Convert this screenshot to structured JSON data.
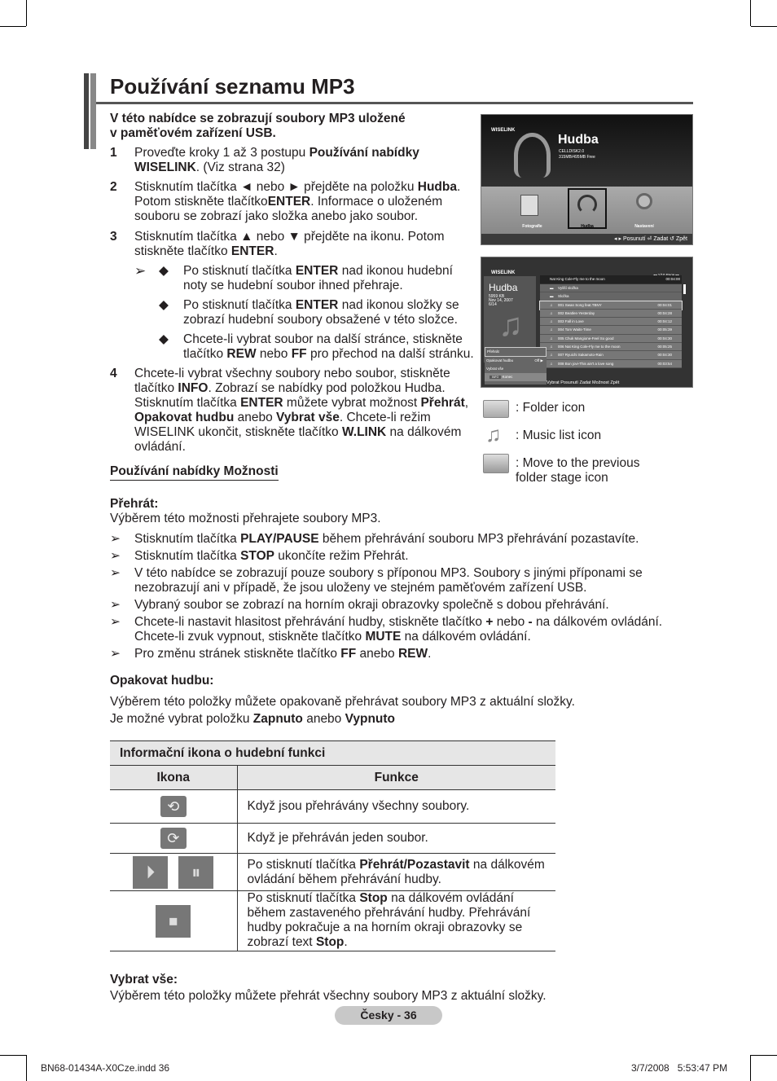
{
  "title": "Používání seznamu MP3",
  "intro": [
    [
      {
        "t": "V této nabídce se zobrazují soubory MP3 uložené",
        "b": 1
      }
    ],
    [
      {
        "t": "v paměťovém zařízení USB.",
        "b": 1
      }
    ]
  ],
  "steps": [
    {
      "n": "1",
      "text": [
        {
          "t": "Proveďte kroky 1 až 3 postupu "
        },
        {
          "t": "Používání nabídky WISELINK",
          "b": 1
        },
        {
          "t": ". (Viz strana 32)"
        }
      ]
    },
    {
      "n": "2",
      "text": [
        {
          "t": "Stisknutím tlačítka ◄ nebo ► přejděte na položku "
        },
        {
          "t": "Hudba",
          "b": 1
        },
        {
          "t": ". Potom stiskněte tlačítko"
        },
        {
          "t": "ENTER",
          "b": 1
        },
        {
          "t": ". Informace o uloženém souboru se zobrazí jako složka anebo jako soubor."
        }
      ]
    },
    {
      "n": "3",
      "text": [
        {
          "t": "Stisknutím tlačítka ▲ nebo ▼ přejděte na ikonu. Potom stiskněte tlačítko "
        },
        {
          "t": "ENTER",
          "b": 1
        },
        {
          "t": "."
        }
      ]
    },
    {
      "n": "4",
      "text": [
        {
          "t": "Chcete-li vybrat všechny soubory nebo soubor, stiskněte tlačítko "
        },
        {
          "t": "INFO",
          "b": 1
        },
        {
          "t": ". Zobrazí se nabídky pod položkou Hudba. Stisknutím tlačítka "
        },
        {
          "t": "ENTER",
          "b": 1
        },
        {
          "t": " můžete vybrat možnost "
        },
        {
          "t": "Přehrát",
          "b": 1
        },
        {
          "t": ", "
        },
        {
          "t": "Opakovat hudbu",
          "b": 1
        },
        {
          "t": " anebo "
        },
        {
          "t": "Vybrat vše",
          "b": 1
        },
        {
          "t": ". Chcete-li režim WISELINK ukončit, stiskněte tlačítko "
        },
        {
          "t": "W.LINK",
          "b": 1
        },
        {
          "t": " na dálkovém ovládání."
        }
      ]
    }
  ],
  "step3_notes": [
    [
      {
        "t": "Po stisknutí tlačítka "
      },
      {
        "t": "ENTER",
        "b": 1
      },
      {
        "t": " nad ikonou hudební noty se hudební soubor ihned přehraje."
      }
    ],
    [
      {
        "t": "Po stisknutí tlačítka "
      },
      {
        "t": "ENTER",
        "b": 1
      },
      {
        "t": " nad ikonou složky se zobrazí hudební soubory obsažené v této složce."
      }
    ],
    [
      {
        "t": "Chcete-li vybrat soubor na další stránce, stiskněte tlačítko "
      },
      {
        "t": "REW",
        "b": 1
      },
      {
        "t": " nebo "
      },
      {
        "t": "FF",
        "b": 1
      },
      {
        "t": " pro přechod na další stránku."
      }
    ]
  ],
  "options_heading": "Používání nabídky Možnosti",
  "play_heading": "Přehrát:",
  "play_desc": "Výběrem této možnosti přehrajete soubory MP3.",
  "play_notes": [
    [
      {
        "t": "Stisknutím tlačítka "
      },
      {
        "t": "PLAY/PAUSE",
        "b": 1
      },
      {
        "t": " během přehrávání souboru MP3 přehrávání pozastavíte."
      }
    ],
    [
      {
        "t": "Stisknutím tlačítka "
      },
      {
        "t": "STOP",
        "b": 1
      },
      {
        "t": " ukončíte režim Přehrát."
      }
    ],
    [
      {
        "t": "V této nabídce se zobrazují pouze soubory s příponou MP3. Soubory s jinými příponami se nezobrazují ani v případě, že jsou uloženy ve stejném paměťovém zařízení USB."
      }
    ],
    [
      {
        "t": "Vybraný soubor se zobrazí na horním okraji obrazovky společně s dobou přehrávání."
      }
    ],
    [
      {
        "t": "Chcete-li nastavit hlasitost přehrávání hudby, stiskněte tlačítko  "
      },
      {
        "t": "+",
        "b": 1
      },
      {
        "t": " nebo "
      },
      {
        "t": "-",
        "b": 1
      },
      {
        "t": " na dálkovém ovládání. Chcete-li zvuk vypnout, stiskněte tlačítko "
      },
      {
        "t": "MUTE",
        "b": 1
      },
      {
        "t": " na dálkovém ovládání."
      }
    ],
    [
      {
        "t": "Pro změnu stránek stiskněte tlačítko "
      },
      {
        "t": "FF",
        "b": 1
      },
      {
        "t": " anebo "
      },
      {
        "t": "REW",
        "b": 1
      },
      {
        "t": "."
      }
    ]
  ],
  "repeat_heading": "Opakovat hudbu:",
  "repeat_desc": [
    [
      {
        "t": "Výběrem této položky můžete opakovaně přehrávat soubory MP3 z aktuální složky."
      }
    ],
    [
      {
        "t": "Je možné vybrat položku "
      },
      {
        "t": "Zapnuto",
        "b": 1
      },
      {
        "t": " anebo "
      },
      {
        "t": "Vypnuto",
        "b": 1
      }
    ]
  ],
  "table": {
    "caption": "Informační ikona o hudební funkci",
    "col_icon": "Ikona",
    "col_func": "Funkce",
    "rows": [
      {
        "icons": [
          "repeat-all-icon"
        ],
        "text": [
          {
            "t": "Když jsou přehrávány všechny soubory."
          }
        ]
      },
      {
        "icons": [
          "repeat-one-icon"
        ],
        "text": [
          {
            "t": "Když je přehráván jeden soubor."
          }
        ]
      },
      {
        "icons": [
          "play-icon",
          "pause-icon"
        ],
        "text": [
          {
            "t": "Po stisknutí tlačítka "
          },
          {
            "t": "Přehrát/Pozastavit",
            "b": 1
          },
          {
            "t": " na dálkovém ovládání během přehrávání hudby."
          }
        ]
      },
      {
        "icons": [
          "stop-icon"
        ],
        "text": [
          {
            "t": "Po stisknutí tlačítka "
          },
          {
            "t": "Stop",
            "b": 1
          },
          {
            "t": " na dálkovém ovládání během zastaveného přehrávání hudby. Přehrávání hudby pokračuje a na horním okraji obrazovky se zobrazí text "
          },
          {
            "t": "Stop",
            "b": 1
          },
          {
            "t": "."
          }
        ]
      }
    ]
  },
  "selectall_heading": "Vybrat vše:",
  "selectall_desc": "Výběrem této položky můžete přehrát všechny soubory MP3 z aktuální složky.",
  "legend": [
    {
      "icon": "folder-icon",
      "label": ": Folder icon"
    },
    {
      "icon": "music-list-icon",
      "label": ": Music list icon"
    },
    {
      "icon": "previous-folder-icon",
      "label": ": Move to the previous folder stage icon"
    }
  ],
  "screen1": {
    "logo": "WISELINK",
    "title": "Hudba",
    "device": "CELLDISK2.0",
    "free": "315MB/495MB Free",
    "menu": [
      "Fotografie",
      "Hudba",
      "Nastavení"
    ],
    "footer": "◂ ▸ Posunutí   ⏎ Zadat   ↺ Zpět"
  },
  "screen2": {
    "logo": "WISELINK",
    "page": "◂◂ 1/10 Page ▸▸",
    "title": "Hudba",
    "size": "5959 KB",
    "date": "Nov 14, 2007",
    "pos": "6/14",
    "now_playing": "Nat King Cole-Fly me to the moon",
    "now_time": "00:04:00",
    "items": [
      {
        "name": "Vyšší složka",
        "time": ""
      },
      {
        "name": "Složka",
        "time": ""
      },
      {
        "name": "001 Swan Song feat.TBNY",
        "time": "00:04:01"
      },
      {
        "name": "002 Beatles-Yesterday",
        "time": "00:04:28"
      },
      {
        "name": "003 Fall in Love",
        "time": "00:04:12"
      },
      {
        "name": "004 Tom Waits-Time",
        "time": "00:05:39"
      },
      {
        "name": "005 Chuk Mangione-Feel So good",
        "time": "00:04:30"
      },
      {
        "name": "006 Nat King Cole-Fly me to the moon",
        "time": "00:05:25"
      },
      {
        "name": "007 Ryuichi Sakamoto-Rain",
        "time": "00:04:30"
      },
      {
        "name": "008 Bon jovi-This ain't a love song",
        "time": "00:03:54"
      }
    ],
    "menu": [
      "Přehrát",
      "Opakovat hudbu",
      "Vybrat vše"
    ],
    "repeat_value": "Off ▶",
    "info_btn": "INFO",
    "exit": "Konec",
    "footer": "Vybrat   Posunutí   Zadat   Možnost   Zpět"
  },
  "page_label": "Česky - 36",
  "footer_file": "BN68-01434A-X0Cze.indd   36",
  "footer_date": "3/7/2008   5:53:47 PM"
}
